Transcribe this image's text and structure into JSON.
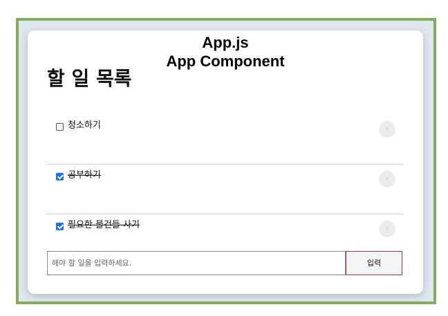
{
  "annotation": {
    "line1": "App.js",
    "line2": "App Component"
  },
  "title": "할 일 목록",
  "todos": [
    {
      "text": "청소하기",
      "done": false,
      "delete_label": "x"
    },
    {
      "text": "공부하기",
      "done": true,
      "delete_label": "x"
    },
    {
      "text": "필요한 물건들 사기",
      "done": true,
      "delete_label": "x"
    }
  ],
  "input": {
    "placeholder": "해야 할 일을 입력하세요.",
    "value": ""
  },
  "submit_label": "입력",
  "colors": {
    "frame_border": "#84ac5f",
    "frame_bg": "#dfe6ee",
    "checkbox_checked": "#1a73e8",
    "submit_border": "#a33a3a"
  }
}
